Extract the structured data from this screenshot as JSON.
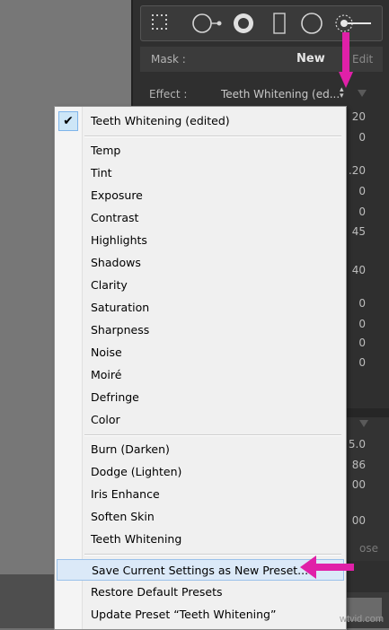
{
  "panel": {
    "mask_label": "Mask :",
    "mask_new": "New",
    "mask_edit": "Edit",
    "effect_label": "Effect :",
    "effect_value": "Teeth Whitening (ed...",
    "slider_values": [
      "20",
      "0",
      ".20",
      "0",
      "0",
      "45",
      "40",
      "0",
      "0",
      "0",
      "0"
    ],
    "lower_values": [
      "5.0",
      "86",
      "00",
      "00"
    ],
    "close_label": "ose"
  },
  "menu": {
    "checked_item": "Teeth Whitening (edited)",
    "group1": [
      "Temp",
      "Tint",
      "Exposure",
      "Contrast",
      "Highlights",
      "Shadows",
      "Clarity",
      "Saturation",
      "Sharpness",
      "Noise",
      "Moiré",
      "Defringe",
      "Color"
    ],
    "group2": [
      "Burn (Darken)",
      "Dodge (Lighten)",
      "Iris Enhance",
      "Soften Skin",
      "Teeth Whitening"
    ],
    "group3": [
      "Save Current Settings as New Preset...",
      "Restore Default Presets",
      "Update Preset “Teeth Whitening”"
    ]
  },
  "watermark": "wtvid.com",
  "colors": {
    "arrow": "#e020a8",
    "highlight": "#dbe9f8"
  }
}
